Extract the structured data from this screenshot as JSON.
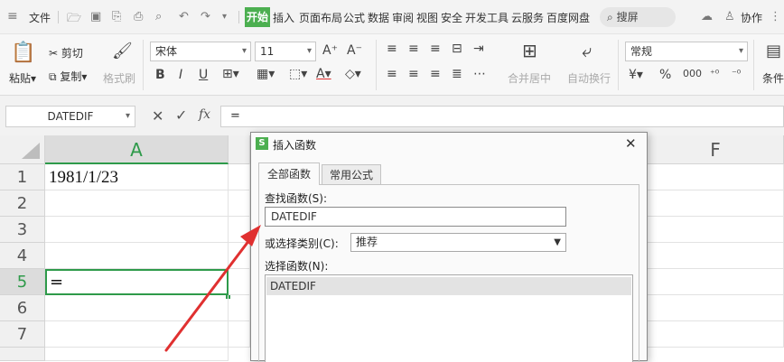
{
  "menubar": {
    "file": "文件",
    "tabs": [
      "开始",
      "插入",
      "页面布局",
      "公式",
      "数据",
      "审阅",
      "视图",
      "安全",
      "开发工具",
      "云服务",
      "百度网盘"
    ],
    "search": "搜屏",
    "collab": "协作"
  },
  "ribbon": {
    "paste": "粘贴",
    "cut": "剪切",
    "copy": "复制",
    "format_painter": "格式刷",
    "font_name": "宋体",
    "font_size": "11",
    "merge_center": "合并居中",
    "auto_wrap": "自动换行",
    "number_format": "常规",
    "conditional": "条件"
  },
  "formulabar": {
    "namebox": "DATEDIF",
    "fx": "fx",
    "content": "="
  },
  "grid": {
    "col_a": "A",
    "col_f": "F",
    "rows": [
      "1",
      "2",
      "3",
      "4",
      "5",
      "6",
      "7"
    ],
    "cell_a1": "1981/1/23",
    "cell_a5": "="
  },
  "dialog": {
    "title": "插入函数",
    "tab_all": "全部函数",
    "tab_common": "常用公式",
    "find_label": "查找函数(S):",
    "find_value": "DATEDIF",
    "category_label": "或选择类别(C):",
    "category_value": "推荐",
    "select_label": "选择函数(N):",
    "functions": [
      "DATEDIF"
    ]
  },
  "colors": {
    "accent_green": "#4caf50",
    "selection_green": "#2e9a4a",
    "arrow_red": "#e03030"
  }
}
